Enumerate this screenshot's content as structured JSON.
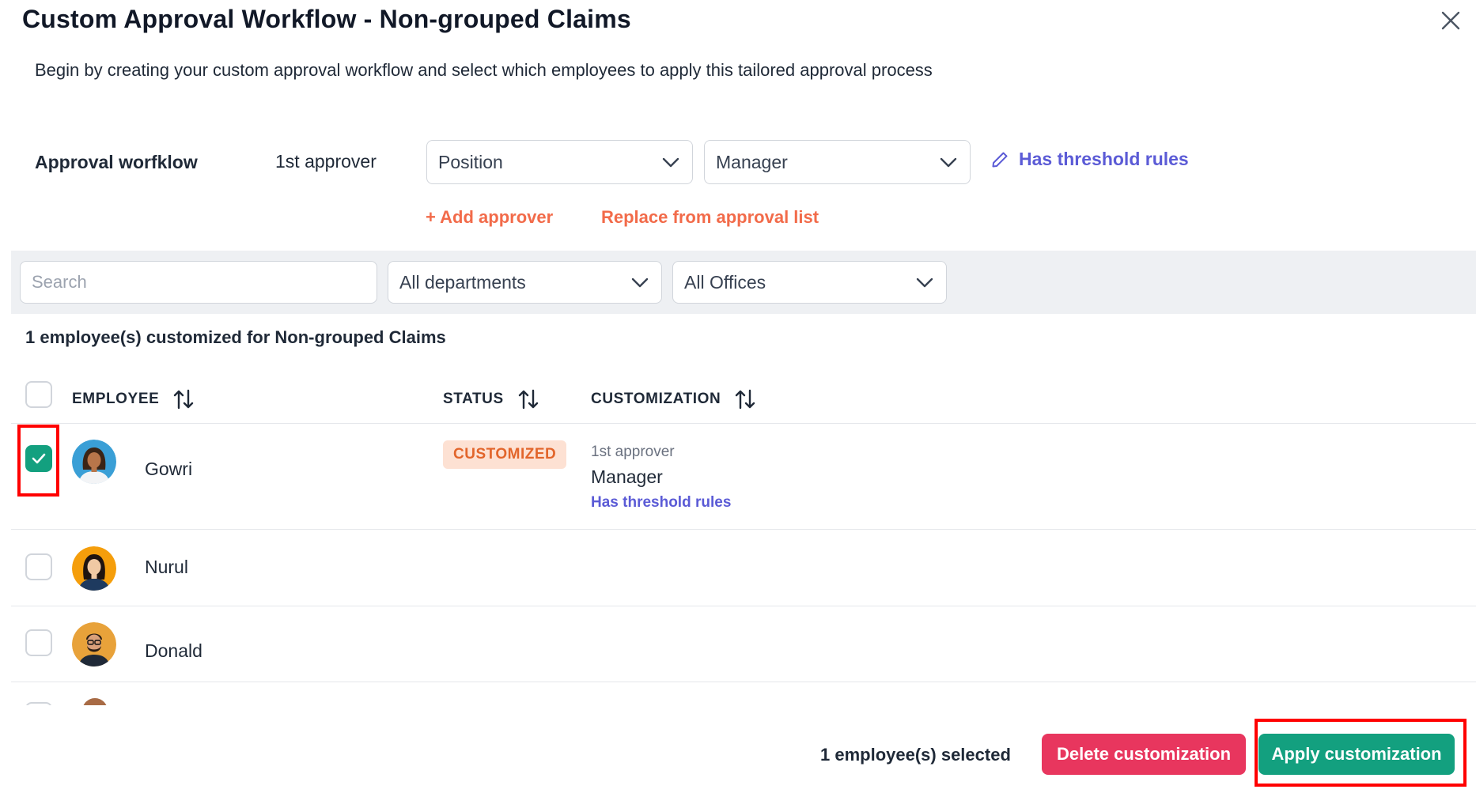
{
  "dialog": {
    "title": "Custom Approval Workflow - Non-grouped Claims",
    "subtitle": "Begin by creating your custom approval workflow and select which employees to apply this tailored approval process"
  },
  "workflow": {
    "label": "Approval worfklow",
    "approver_label": "1st approver",
    "type_select": "Position",
    "value_select": "Manager",
    "threshold_link": "Has threshold rules",
    "add_approver": "+ Add approver",
    "replace_link": "Replace from approval list"
  },
  "filters": {
    "search_placeholder": "Search",
    "department": "All departments",
    "office": "All Offices"
  },
  "summary": "1 employee(s) customized for Non-grouped Claims",
  "table": {
    "headers": {
      "employee": "EMPLOYEE",
      "status": "STATUS",
      "customization": "CUSTOMIZATION"
    },
    "rows": [
      {
        "name": "Gowri",
        "checked": true,
        "status": "CUSTOMIZED",
        "customization": {
          "approver_label": "1st approver",
          "value": "Manager",
          "link": "Has threshold rules"
        }
      },
      {
        "name": "Nurul",
        "checked": false
      },
      {
        "name": "Donald",
        "checked": false
      }
    ]
  },
  "footer": {
    "selected_text": "1 employee(s) selected",
    "delete_label": "Delete customization",
    "apply_label": "Apply customization"
  },
  "colors": {
    "accent_green": "#13a07f",
    "delete_red": "#e8365e",
    "link_orange": "#f26b4a",
    "link_purple": "#5b5bd6",
    "badge_bg": "#fde1d3",
    "highlight": "#ff0000"
  },
  "icons": [
    "close-icon",
    "chevron-down-icon",
    "pencil-icon",
    "sort-icon",
    "check-icon"
  ]
}
